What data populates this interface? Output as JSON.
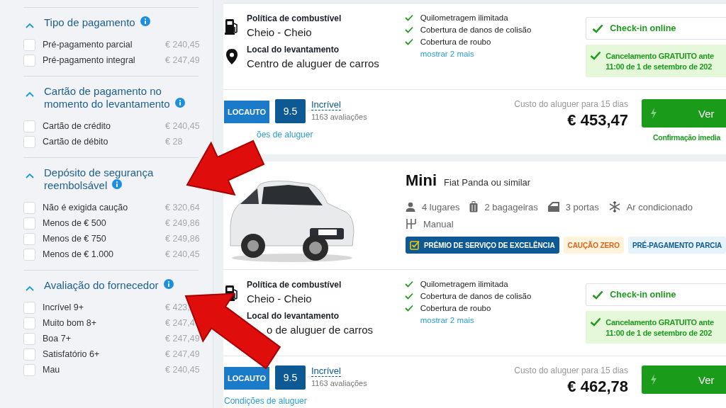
{
  "sidebar": {
    "sections": [
      {
        "title": "Tipo de pagamento",
        "info": true,
        "expanded": true,
        "options": [
          {
            "label": "Pré-pagamento parcial",
            "price": "€ 240,45",
            "checked": false
          },
          {
            "label": "Pré-pagamento integral",
            "price": "€ 247,49",
            "checked": false
          }
        ]
      },
      {
        "title": "Cartão de pagamento no momento do levantamento",
        "info": true,
        "expanded": true,
        "options": [
          {
            "label": "Cartão de crédito",
            "price": "€ 240,45",
            "checked": false
          },
          {
            "label": "Cartão de débito",
            "price": "€ 28",
            "checked": false
          }
        ]
      },
      {
        "title": "Depósito de segurança reembolsável",
        "info": true,
        "expanded": true,
        "options": [
          {
            "label": "Não é exigida caução",
            "price": "€ 320,64",
            "checked": false
          },
          {
            "label": "Menos de € 500",
            "price": "€ 249,86",
            "checked": false
          },
          {
            "label": "Menos de € 750",
            "price": "€ 249,86",
            "checked": false
          },
          {
            "label": "Menos de € 1.000",
            "price": "€ 240,45",
            "checked": false
          }
        ]
      },
      {
        "title": "Avaliação do fornecedor",
        "info": true,
        "expanded": true,
        "options": [
          {
            "label": "Incrível 9+",
            "price": "€ 423,",
            "checked": false
          },
          {
            "label": "Muito bom 8+",
            "price": "€ 247,4",
            "checked": false
          },
          {
            "label": "Boa 7+",
            "price": "€ 247,49",
            "checked": false
          },
          {
            "label": "Satisfatório 6+",
            "price": "€ 247,49",
            "checked": false
          },
          {
            "label": "Mau",
            "price": "€ 240,45",
            "checked": false
          }
        ]
      }
    ]
  },
  "cards": [
    {
      "fuel": {
        "label": "Política de combustível",
        "value": "Cheio - Cheio"
      },
      "pickup": {
        "label": "Local do levantamento",
        "value": "Centro de aluguer de carros"
      },
      "inclusions": [
        "Quilometragem ilimitada",
        "Cobertura de danos de colisão",
        "Cobertura de roubo"
      ],
      "more": "mostrar 2 mais",
      "checkin": "Check-in online",
      "cancellation": [
        "Cancelamento GRATUITO ante",
        "11:00 de 1 de setembro de 202"
      ],
      "supplier": {
        "logo": "LOCAUTO",
        "score": "9.5",
        "rating": "Incrível",
        "reviews": "1163 avaliações",
        "conditions": "ões de aluguer"
      },
      "price_label": "Custo do aluguer para 15 dias",
      "price": "€ 453,47",
      "button": "Ver",
      "confirmation": "Confirmação imedia"
    },
    {
      "car": {
        "category": "Mini",
        "model": "Fiat Panda ou similar",
        "features": [
          {
            "kind": "seats",
            "text": "4 lugares"
          },
          {
            "kind": "bags",
            "text": "2 bagageiras"
          },
          {
            "kind": "doors",
            "text": "3 portas"
          },
          {
            "kind": "aircon",
            "text": "Ar condicionado"
          },
          {
            "kind": "transmission",
            "text": "Manual"
          }
        ],
        "badges": [
          {
            "kind": "award",
            "text": "PRÉMIO DE SERVIÇO DE EXCELÊNCIA"
          },
          {
            "kind": "deposit",
            "text": "CAUÇÃO ZERO"
          },
          {
            "kind": "prepay",
            "text": "PRÉ-PAGAMENTO PARCIA"
          }
        ]
      },
      "fuel": {
        "label": "Política de combustível",
        "value": "Cheio - Cheio"
      },
      "pickup": {
        "label": "Local do levantamento",
        "value": "o de aluguer de carros"
      },
      "inclusions": [
        "Quilometragem ilimitada",
        "Cobertura de danos de colisão",
        "Cobertura de roubo"
      ],
      "more": "mostrar 2 mais",
      "checkin": "Check-in online",
      "cancellation": [
        "Cancelamento GRATUITO ante",
        "11:00 de 1 de setembro de 202"
      ],
      "supplier": {
        "logo": "LOCAUTO",
        "score": "9.5",
        "rating": "Incrível",
        "reviews": "1163 avaliações",
        "conditions": "Condições de aluguer"
      },
      "price_label": "Custo do aluguer para 15 dias",
      "price": "€ 462,78",
      "button": "Ver"
    }
  ]
}
